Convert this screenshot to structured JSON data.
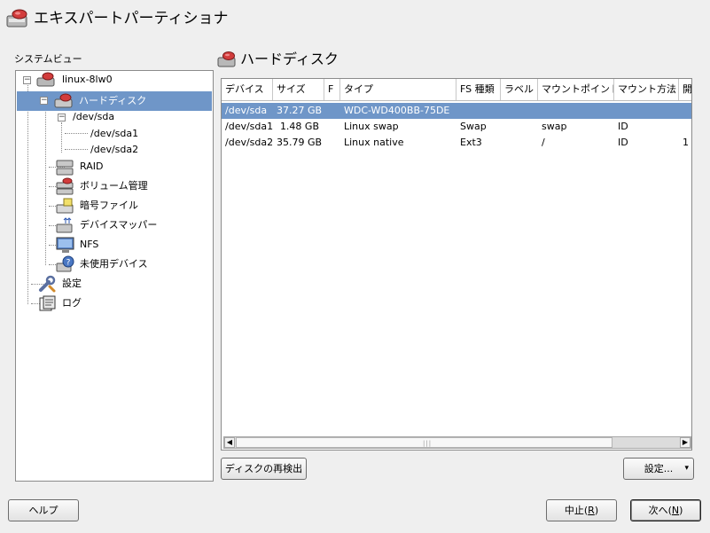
{
  "window": {
    "title": "エキスパートパーティショナ"
  },
  "sidebar": {
    "label": "システムビュー",
    "tree": {
      "host": "linux-8lw0",
      "harddisk": "ハードディスク",
      "sda": "/dev/sda",
      "sda1": "/dev/sda1",
      "sda2": "/dev/sda2",
      "raid": "RAID",
      "volume": "ボリューム管理",
      "crypt": "暗号ファイル",
      "devmapper": "デバイスマッパー",
      "nfs": "NFS",
      "unused": "未使用デバイス",
      "settings": "設定",
      "log": "ログ"
    }
  },
  "main": {
    "title": "ハードディスク",
    "columns": [
      "デバイス",
      "サイズ",
      "F",
      "タイプ",
      "FS 種類",
      "ラベル",
      "マウントポイント",
      "マウント方法",
      "開"
    ],
    "rows": [
      [
        "/dev/sda",
        "37.27 GB",
        "",
        "WDC-WD400BB-75DE",
        "",
        "",
        "",
        "",
        ""
      ],
      [
        "/dev/sda1",
        "1.48 GB",
        "",
        "Linux swap",
        "Swap",
        "",
        "swap",
        "ID",
        ""
      ],
      [
        "/dev/sda2",
        "35.79 GB",
        "",
        "Linux native",
        "Ext3",
        "",
        "/",
        "ID",
        "1"
      ]
    ],
    "selected_row": 0,
    "scrollbar_grip": "|||"
  },
  "buttons": {
    "rescan": "ディスクの再検出",
    "settings": "設定...",
    "settings_arrow": "▾",
    "help": "ヘルプ",
    "abort_prefix": "中止(",
    "abort_key": "R",
    "abort_suffix": ")",
    "next_prefix": "次へ(",
    "next_key": "N",
    "next_suffix": ")"
  },
  "colors": {
    "selection": "#6f96c8",
    "disk_red": "#d23c3c"
  }
}
